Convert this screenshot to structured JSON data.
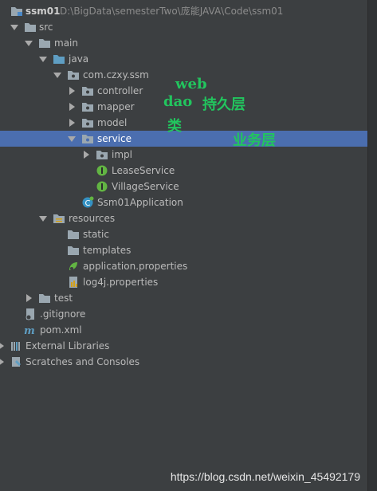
{
  "tree": {
    "root_name": "ssm01",
    "root_path": "D:\\BigData\\semesterTwo\\庞能JAVA\\Code\\ssm01",
    "src": "src",
    "main": "main",
    "java": "java",
    "package": "com.czxy.ssm",
    "controller": "controller",
    "mapper": "mapper",
    "model": "model",
    "service": "service",
    "impl": "impl",
    "lease_service": "LeaseService",
    "village_service": "VillageService",
    "application": "Ssm01Application",
    "resources": "resources",
    "static": "static",
    "templates": "templates",
    "application_properties": "application.properties",
    "log4j_properties": "log4j.properties",
    "test": "test",
    "gitignore": ".gitignore",
    "pom": "pom.xml",
    "external_libraries": "External Libraries",
    "scratches": "Scratches and Consoles"
  },
  "annotations": {
    "web": "web",
    "dao": "dao",
    "persistence": "持久层",
    "lei": "类",
    "business": "业务层"
  },
  "watermark": "https://blog.csdn.net/weixin_45492179",
  "colors": {
    "background": "#3c3f41",
    "selection": "#4b6eaf",
    "text": "#bbbbbb",
    "folder": "#9aa7b0",
    "source_folder": "#5f9ec3",
    "interface_icon": "#62b543",
    "annotation": "#22c55e"
  }
}
